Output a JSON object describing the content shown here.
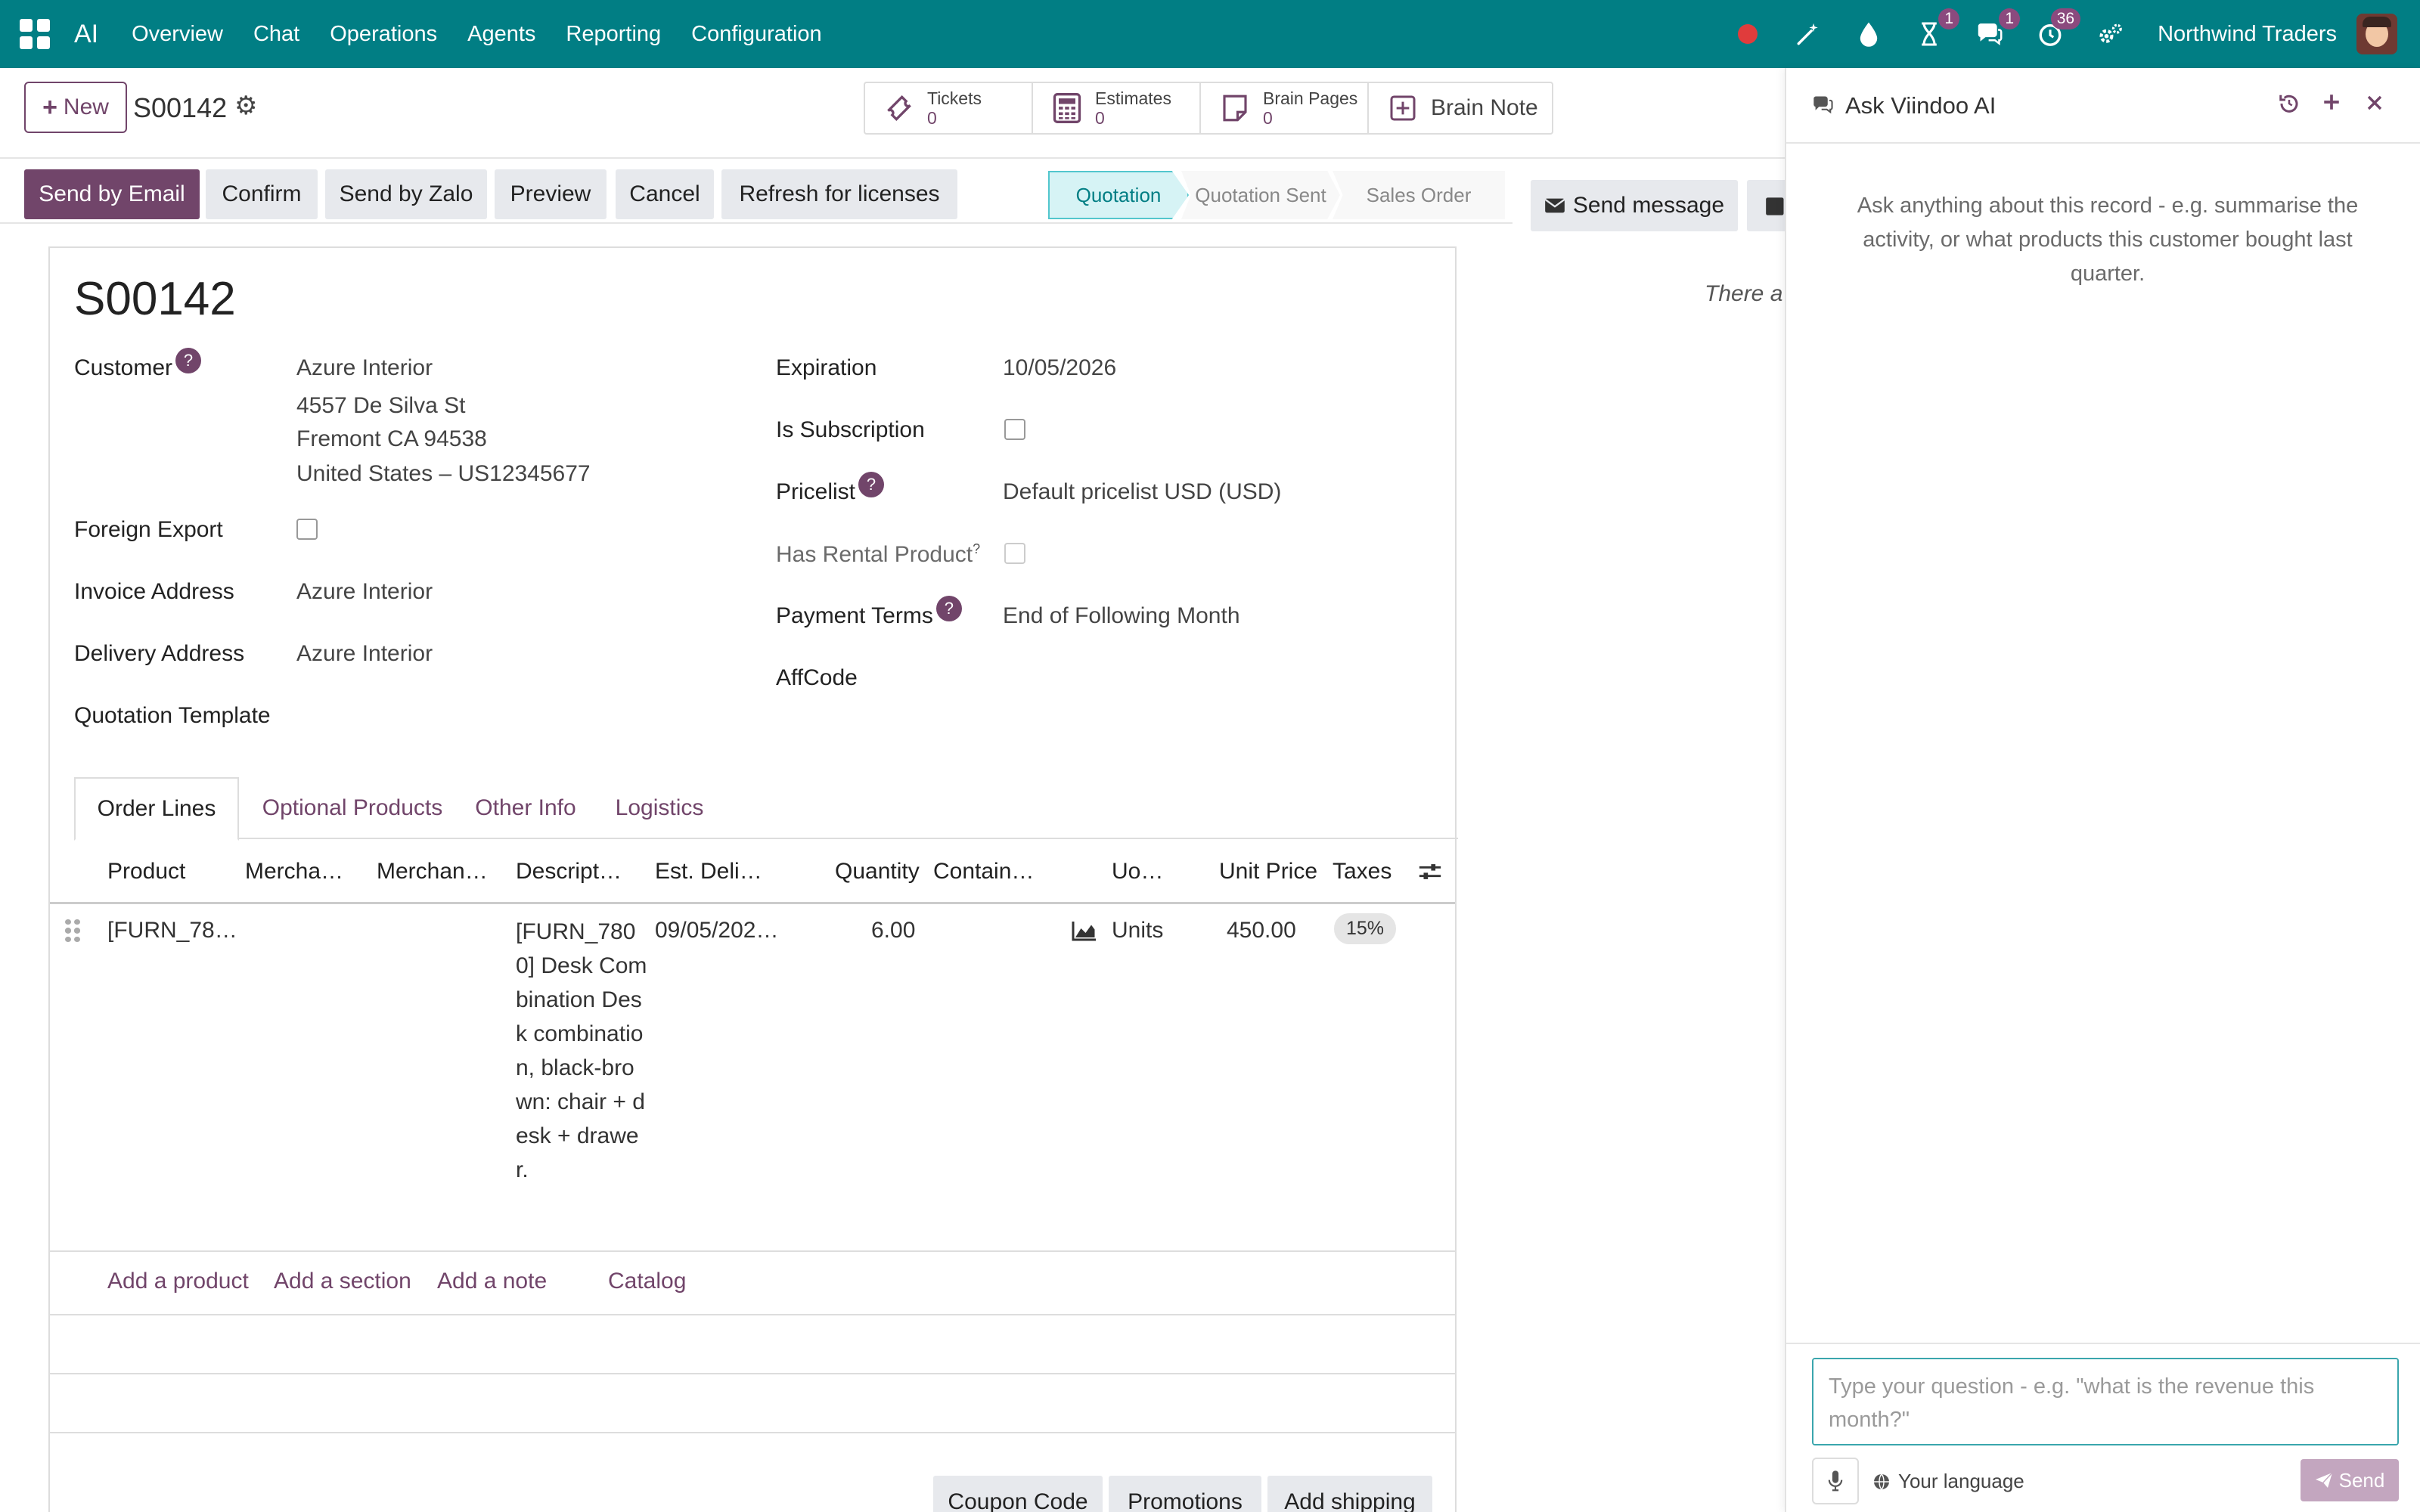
{
  "navbar": {
    "app_name": "AI",
    "menu": [
      "Overview",
      "Chat",
      "Operations",
      "Agents",
      "Reporting",
      "Configuration"
    ],
    "activity_badge": "1",
    "messages_badge": "1",
    "timer_badge": "36",
    "company": "Northwind Traders",
    "accent_color": "#017e84"
  },
  "control": {
    "new_label": "New",
    "record_name": "S00142",
    "smart_buttons": [
      {
        "label": "Tickets",
        "count": "0",
        "icon": "ticket-icon"
      },
      {
        "label": "Estimates",
        "count": "0",
        "icon": "calculator-icon"
      },
      {
        "label": "Brain Pages",
        "count": "0",
        "icon": "page-icon"
      },
      {
        "label": "Brain Note",
        "icon": "plus-square-icon"
      }
    ]
  },
  "actions": {
    "send_email": "Send by Email",
    "confirm": "Confirm",
    "send_zalo": "Send by Zalo",
    "preview": "Preview",
    "cancel": "Cancel",
    "refresh": "Refresh for licenses"
  },
  "stages": [
    "Quotation",
    "Quotation Sent",
    "Sales Order"
  ],
  "form": {
    "title": "S00142",
    "customer_label": "Customer",
    "customer_name": "Azure Interior",
    "customer_addr1": "4557 De Silva St",
    "customer_addr2": "Fremont CA 94538",
    "customer_addr3": "United States – US12345677",
    "foreign_export_label": "Foreign Export",
    "invoice_address_label": "Invoice Address",
    "invoice_address": "Azure Interior",
    "delivery_address_label": "Delivery Address",
    "delivery_address": "Azure Interior",
    "quotation_template_label": "Quotation Template",
    "expiration_label": "Expiration",
    "expiration": "10/05/2026",
    "is_subscription_label": "Is Subscription",
    "pricelist_label": "Pricelist",
    "pricelist": "Default pricelist USD  (USD)",
    "has_rental_label": "Has Rental Product",
    "has_rental_help": "?",
    "payment_terms_label": "Payment Terms",
    "payment_terms": "End of Following Month",
    "affcode_label": "AffCode",
    "help_mark": "?"
  },
  "tabs": [
    "Order Lines",
    "Optional Products",
    "Other Info",
    "Logistics"
  ],
  "order_lines": {
    "columns": [
      "Product",
      "Mercha…",
      "Merchan…",
      "Descript…",
      "Est. Deli…",
      "Quantity",
      "Contain…",
      "Uo…",
      "Unit Price",
      "Taxes"
    ],
    "rows": [
      {
        "product": "[FURN_78…",
        "description": "[FURN_7800] Desk Combination Desk combination, black-brown: chair + desk + drawer.",
        "est_delivery": "09/05/202…",
        "quantity": "6.00",
        "uom": "Units",
        "unit_price": "450.00",
        "taxes": "15%"
      }
    ],
    "add_product": "Add a product",
    "add_section": "Add a section",
    "add_note": "Add a note",
    "catalog": "Catalog"
  },
  "footer_buttons": [
    "Coupon Code",
    "Promotions",
    "Add shipping"
  ],
  "chatter": {
    "send_message": "Send message",
    "empty_text": "There a"
  },
  "ai_panel": {
    "title": "Ask Viindoo AI",
    "hint": "Ask anything about this record - e.g. summarise the activity, or what products this customer bought last quarter.",
    "placeholder": "Type your question - e.g. \"what is the revenue this month?\"",
    "language": "Your language",
    "send": "Send"
  }
}
